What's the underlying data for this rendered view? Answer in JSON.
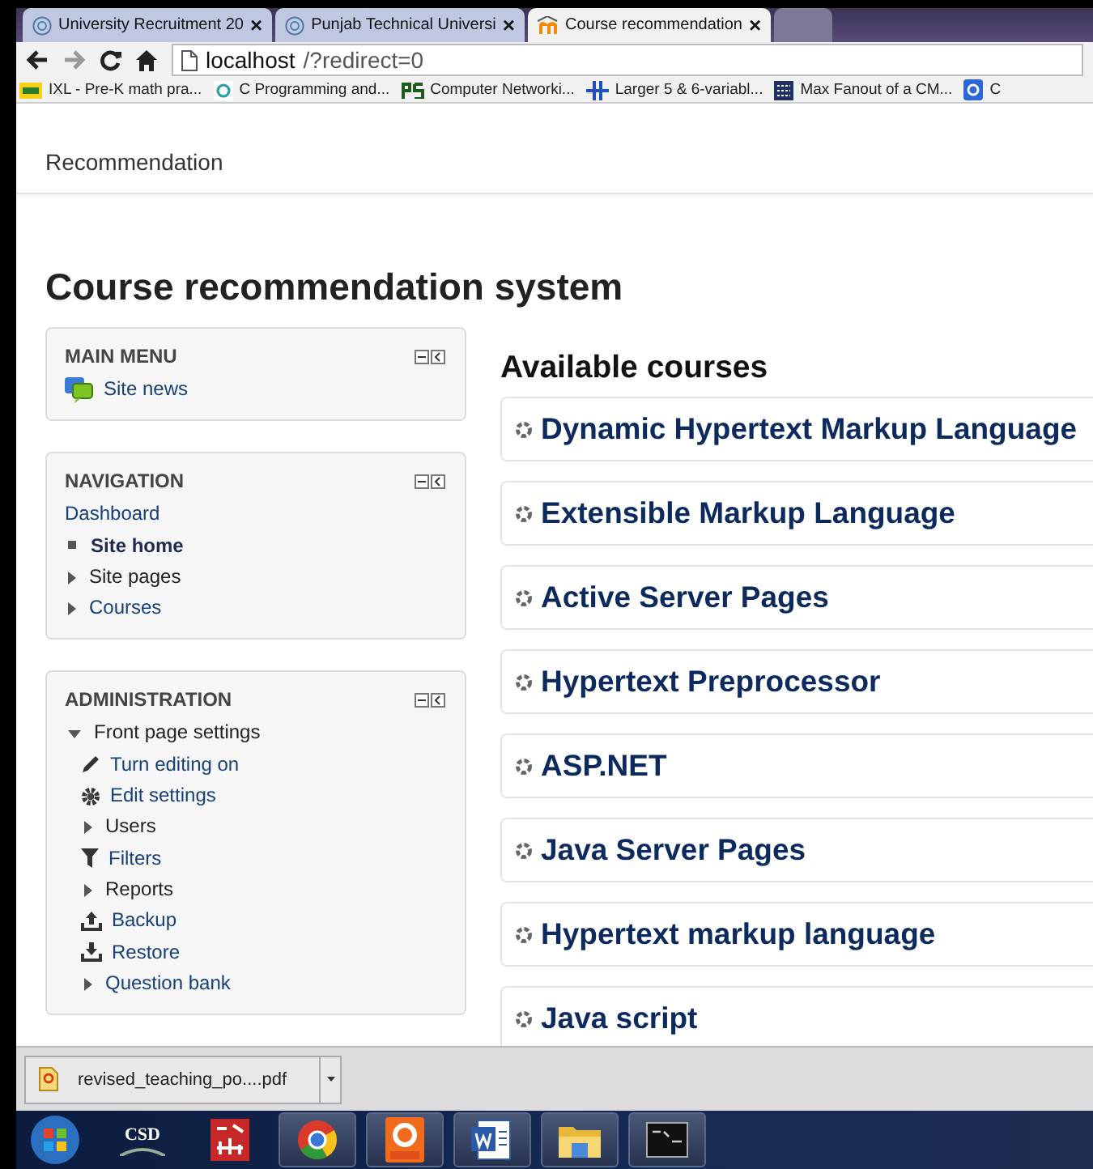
{
  "tabs": [
    {
      "title": "University Recruitment 20",
      "close": "×",
      "selected": false
    },
    {
      "title": "Punjab Technical Universi",
      "close": "×",
      "selected": false
    },
    {
      "title": "Course recommendation",
      "close": "×",
      "selected": true
    }
  ],
  "address_bar": {
    "url_host": "localhost",
    "url_path": "/?redirect=0"
  },
  "bookmarks": [
    {
      "label": "IXL - Pre-K math pra..."
    },
    {
      "label": "C Programming and..."
    },
    {
      "label": "Computer Networki..."
    },
    {
      "label": "Larger 5 & 6-variabl..."
    },
    {
      "label": "Max Fanout of a CM..."
    },
    {
      "label": "C"
    }
  ],
  "site_header": {
    "title": "Recommendation"
  },
  "page_title": "Course recommendation system",
  "blocks": [
    {
      "title": "MAIN MENU",
      "items": [
        {
          "label": "Site news",
          "kind": "chat",
          "link": true,
          "current": false
        }
      ]
    },
    {
      "title": "NAVIGATION",
      "items": [
        {
          "label": "Dashboard",
          "kind": "plain",
          "link": true,
          "current": false
        },
        {
          "label": "Site home",
          "kind": "bullet",
          "link": true,
          "current": true
        },
        {
          "label": "Site pages",
          "kind": "branch",
          "link": false,
          "current": false
        },
        {
          "label": "Courses",
          "kind": "branch",
          "link": true,
          "current": false
        }
      ]
    },
    {
      "title": "ADMINISTRATION",
      "items": [
        {
          "label": "Front page settings",
          "kind": "open",
          "link": false,
          "current": false,
          "children": [
            {
              "label": "Turn editing on",
              "kind": "pencil",
              "link": true,
              "current": false
            },
            {
              "label": "Edit settings",
              "kind": "gear",
              "link": true,
              "current": false
            },
            {
              "label": "Users",
              "kind": "branch",
              "link": false,
              "current": false
            },
            {
              "label": "Filters",
              "kind": "filter",
              "link": true,
              "current": false
            },
            {
              "label": "Reports",
              "kind": "branch",
              "link": false,
              "current": false
            },
            {
              "label": "Backup",
              "kind": "upload",
              "link": true,
              "current": false
            },
            {
              "label": "Restore",
              "kind": "download",
              "link": true,
              "current": false
            },
            {
              "label": "Question bank",
              "kind": "branch",
              "link": true,
              "current": false
            }
          ]
        }
      ]
    }
  ],
  "available_courses": {
    "heading": "Available courses",
    "courses": [
      {
        "name": "Dynamic Hypertext Markup Language"
      },
      {
        "name": "Extensible Markup Language"
      },
      {
        "name": "Active Server Pages"
      },
      {
        "name": "Hypertext Preprocessor"
      },
      {
        "name": "ASP.NET"
      },
      {
        "name": "Java Server Pages"
      },
      {
        "name": "Hypertext markup language"
      },
      {
        "name": "Java script"
      }
    ]
  },
  "download_bar": {
    "file": "revised_teaching_po....pdf"
  },
  "taskbar": {
    "items": [
      {
        "kind": "start"
      },
      {
        "kind": "csd",
        "label": "CSD"
      },
      {
        "kind": "math"
      },
      {
        "kind": "chrome"
      },
      {
        "kind": "pdf"
      },
      {
        "kind": "word"
      },
      {
        "kind": "folder"
      },
      {
        "kind": "cmd"
      }
    ]
  }
}
